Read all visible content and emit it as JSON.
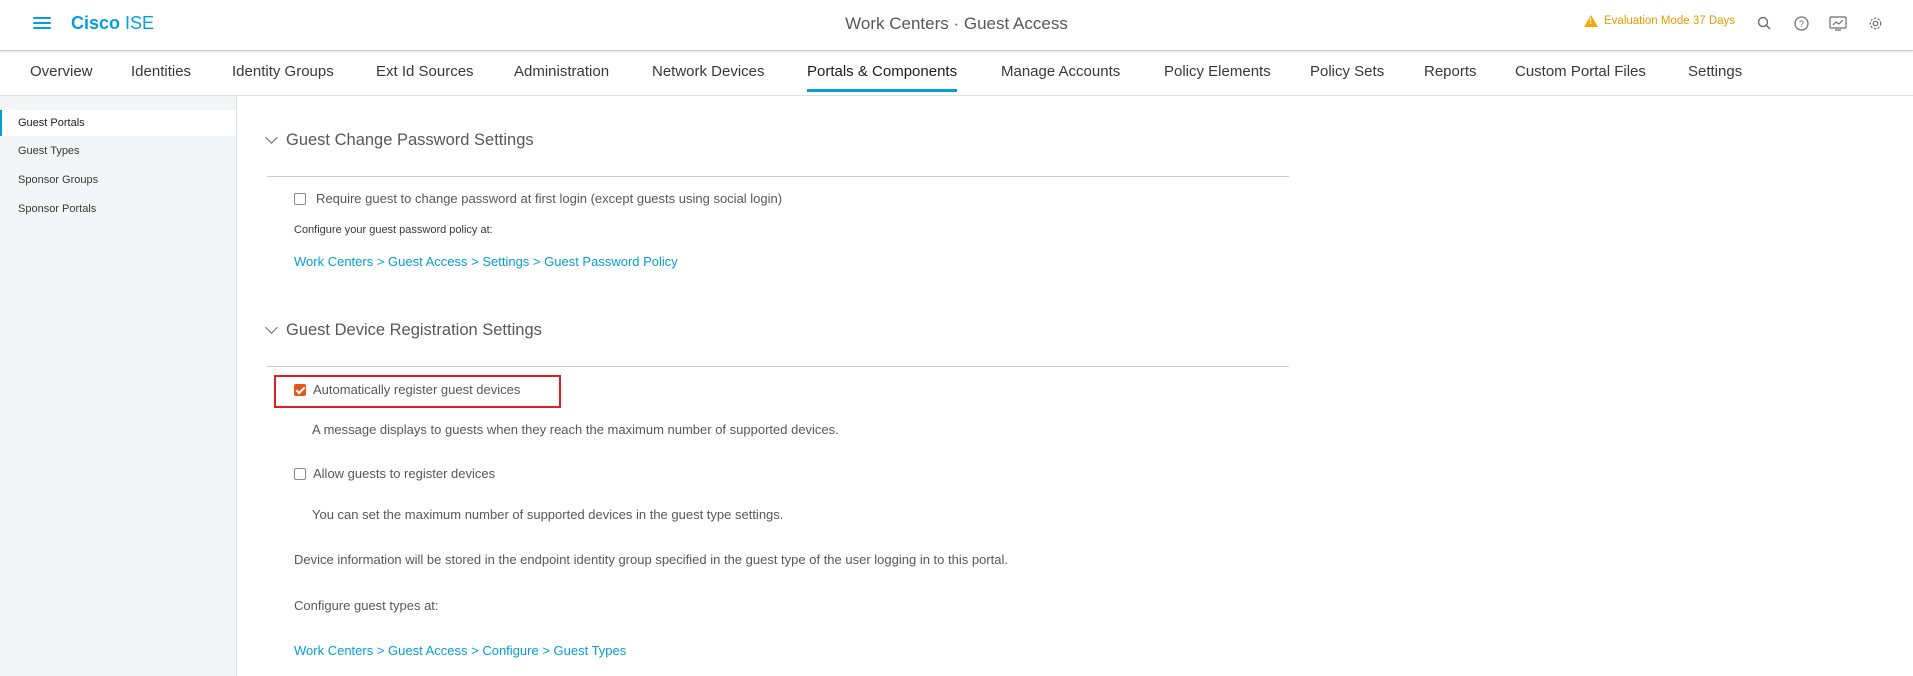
{
  "header": {
    "logo_brand": "Cisco",
    "logo_product": "ISE",
    "title": "Work Centers · Guest Access",
    "evaluation": "Evaluation Mode 37 Days",
    "icons": [
      "search-icon",
      "help-icon",
      "dashboard-icon",
      "gear-icon"
    ]
  },
  "tabs": [
    {
      "label": "Overview"
    },
    {
      "label": "Identities"
    },
    {
      "label": "Identity Groups"
    },
    {
      "label": "Ext Id Sources"
    },
    {
      "label": "Administration"
    },
    {
      "label": "Network Devices"
    },
    {
      "label": "Portals & Components",
      "active": true
    },
    {
      "label": "Manage Accounts"
    },
    {
      "label": "Policy Elements"
    },
    {
      "label": "Policy Sets"
    },
    {
      "label": "Reports"
    },
    {
      "label": "Custom Portal Files"
    },
    {
      "label": "Settings"
    }
  ],
  "sidebar": {
    "items": [
      {
        "label": "Guest Portals",
        "active": true
      },
      {
        "label": "Guest Types"
      },
      {
        "label": "Sponsor Groups"
      },
      {
        "label": "Sponsor Portals"
      }
    ]
  },
  "password_section": {
    "title": "Guest Change Password Settings",
    "require_change_label": "Require guest to change password at first login (except guests using social login)",
    "require_change_checked": false,
    "policy_hint": "Configure your guest password policy at:",
    "policy_link": "Work Centers > Guest Access > Settings > Guest Password Policy"
  },
  "device_section": {
    "title": "Guest Device Registration Settings",
    "auto_register_label": "Automatically register guest devices",
    "auto_register_checked": true,
    "auto_register_note": "A message displays to guests when they reach the maximum number of supported devices.",
    "allow_register_label": "Allow guests to register devices",
    "allow_register_checked": false,
    "allow_register_note": "You can set the maximum number of supported devices in the guest type settings.",
    "storage_note": "Device information will be stored in the endpoint identity group specified in the guest type of the user logging in to this portal.",
    "types_hint": "Configure guest types at:",
    "types_link": "Work Centers > Guest Access > Configure > Guest Types"
  },
  "colors": {
    "accent": "#049fd9",
    "checkbox_checked": "#e2581b",
    "warning": "#eb9a00",
    "highlight_border": "#e02020"
  }
}
